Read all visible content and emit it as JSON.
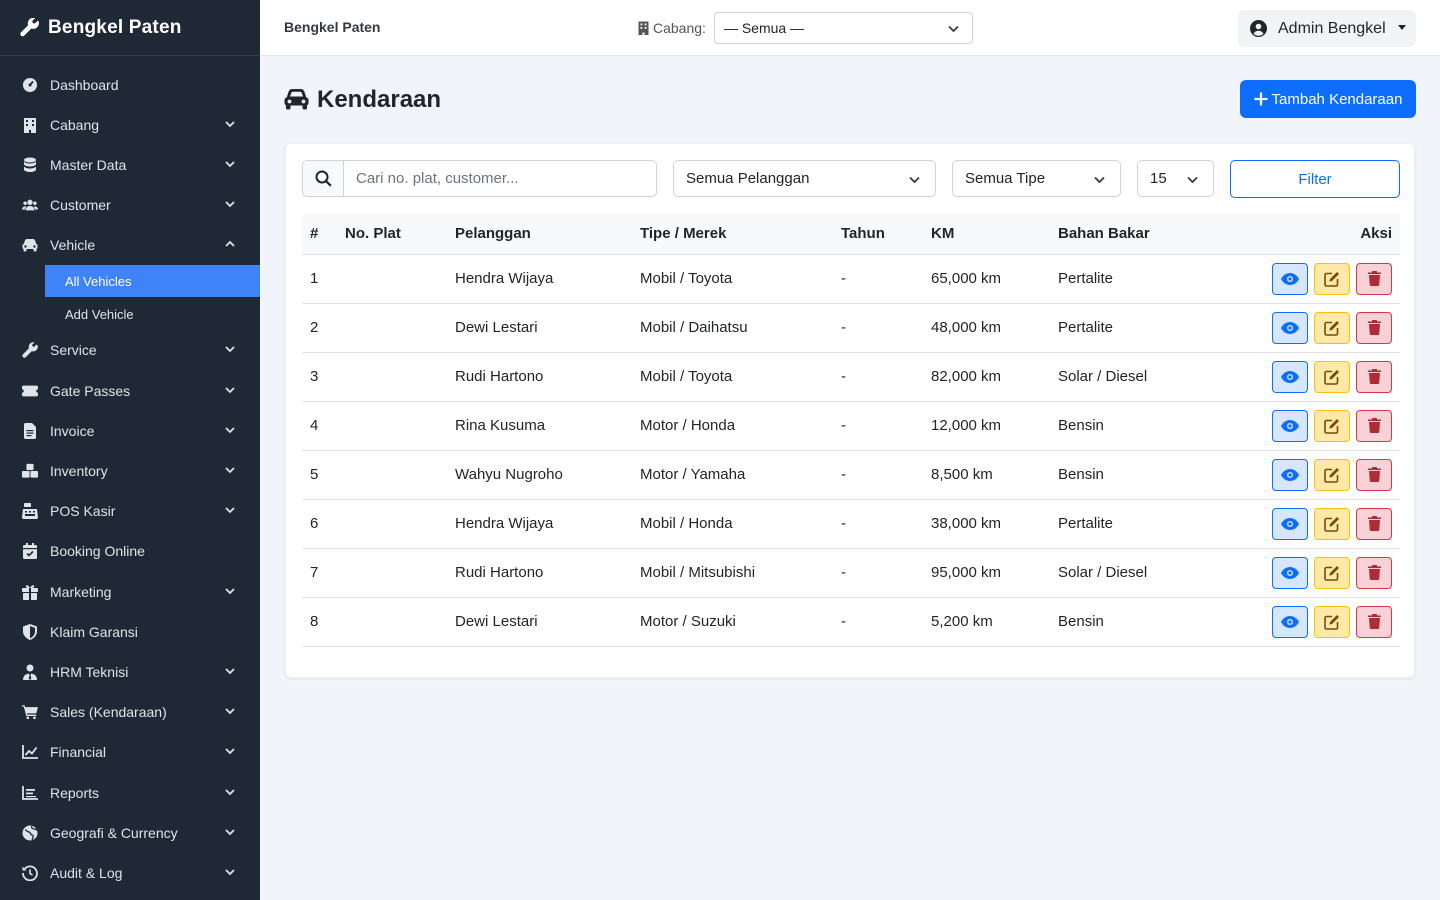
{
  "sidebar": {
    "brand": "Bengkel Paten",
    "items": [
      {
        "label": "Dashboard"
      },
      {
        "label": "Cabang"
      },
      {
        "label": "Master Data"
      },
      {
        "label": "Customer"
      },
      {
        "label": "Vehicle"
      },
      {
        "label": "Service"
      },
      {
        "label": "Gate Passes"
      },
      {
        "label": "Invoice"
      },
      {
        "label": "Inventory"
      },
      {
        "label": "POS Kasir"
      },
      {
        "label": "Booking Online"
      },
      {
        "label": "Marketing"
      },
      {
        "label": "Klaim Garansi"
      },
      {
        "label": "HRM Teknisi"
      },
      {
        "label": "Sales (Kendaraan)"
      },
      {
        "label": "Financial"
      },
      {
        "label": "Reports"
      },
      {
        "label": "Geografi & Currency"
      },
      {
        "label": "Audit & Log"
      }
    ],
    "vehicle_sub": [
      {
        "label": "All Vehicles",
        "active": true
      },
      {
        "label": "Add Vehicle"
      }
    ]
  },
  "topbar": {
    "brand": "Bengkel Paten",
    "branch_label": "Cabang:",
    "branch_value": "— Semua —",
    "user_name": "Admin Bengkel"
  },
  "page": {
    "title": "Kendaraan",
    "add_button": "Tambah Kendaraan"
  },
  "filters": {
    "search_placeholder": "Cari no. plat, customer...",
    "customer_select": "Semua Pelanggan",
    "type_select": "Semua Tipe",
    "per_page": "15",
    "filter_button": "Filter"
  },
  "table": {
    "headers": [
      "#",
      "No. Plat",
      "Pelanggan",
      "Tipe / Merek",
      "Tahun",
      "KM",
      "Bahan Bakar",
      "Aksi"
    ],
    "rows": [
      {
        "no": "1",
        "plat": "",
        "pelanggan": "Hendra Wijaya",
        "tipe": "Mobil / Toyota",
        "tahun": "-",
        "km": "65,000 km",
        "bbm": "Pertalite"
      },
      {
        "no": "2",
        "plat": "",
        "pelanggan": "Dewi Lestari",
        "tipe": "Mobil / Daihatsu",
        "tahun": "-",
        "km": "48,000 km",
        "bbm": "Pertalite"
      },
      {
        "no": "3",
        "plat": "",
        "pelanggan": "Rudi Hartono",
        "tipe": "Mobil / Toyota",
        "tahun": "-",
        "km": "82,000 km",
        "bbm": "Solar / Diesel"
      },
      {
        "no": "4",
        "plat": "",
        "pelanggan": "Rina Kusuma",
        "tipe": "Motor / Honda",
        "tahun": "-",
        "km": "12,000 km",
        "bbm": "Bensin"
      },
      {
        "no": "5",
        "plat": "",
        "pelanggan": "Wahyu Nugroho",
        "tipe": "Motor / Yamaha",
        "tahun": "-",
        "km": "8,500 km",
        "bbm": "Bensin"
      },
      {
        "no": "6",
        "plat": "",
        "pelanggan": "Hendra Wijaya",
        "tipe": "Mobil / Honda",
        "tahun": "-",
        "km": "38,000 km",
        "bbm": "Pertalite"
      },
      {
        "no": "7",
        "plat": "",
        "pelanggan": "Rudi Hartono",
        "tipe": "Mobil / Mitsubishi",
        "tahun": "-",
        "km": "95,000 km",
        "bbm": "Solar / Diesel"
      },
      {
        "no": "8",
        "plat": "",
        "pelanggan": "Dewi Lestari",
        "tipe": "Motor / Suzuki",
        "tahun": "-",
        "km": "5,200 km",
        "bbm": "Bensin"
      }
    ]
  },
  "colors": {
    "sidebar_bg": "#1f2935",
    "accent": "#0d6efd",
    "active_item": "#3f83f8",
    "page_bg": "#f1f4f9"
  }
}
